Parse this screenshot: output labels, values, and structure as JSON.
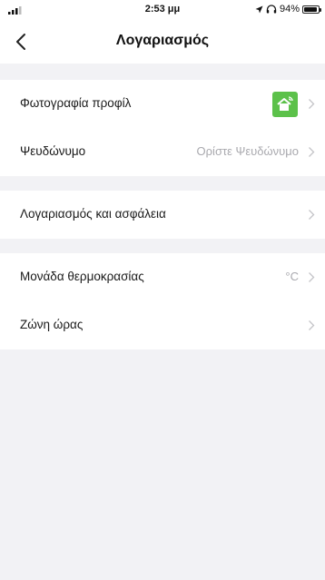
{
  "status_bar": {
    "time": "2:53 μμ",
    "battery": "94%",
    "battery_level": 0.94
  },
  "header": {
    "title": "Λογαριασμός"
  },
  "groups": [
    {
      "items": [
        {
          "label": "Φωτογραφία προφίλ",
          "type": "avatar"
        },
        {
          "label": "Ψευδώνυμο",
          "value": "Ορίστε Ψευδώνυμο"
        }
      ]
    },
    {
      "items": [
        {
          "label": "Λογαριασμός και ασφάλεια"
        }
      ]
    },
    {
      "items": [
        {
          "label": "Μονάδα θερμοκρασίας",
          "value": "°C"
        },
        {
          "label": "Ζώνη ώρας"
        }
      ]
    }
  ],
  "colors": {
    "background": "#f2f2f5",
    "avatar_green": "#5cc14a",
    "secondary_text": "#a9a9ae"
  },
  "icons": {
    "back": "chevron-left-icon",
    "row_arrow": "chevron-right-icon",
    "avatar": "smart-home-icon"
  }
}
